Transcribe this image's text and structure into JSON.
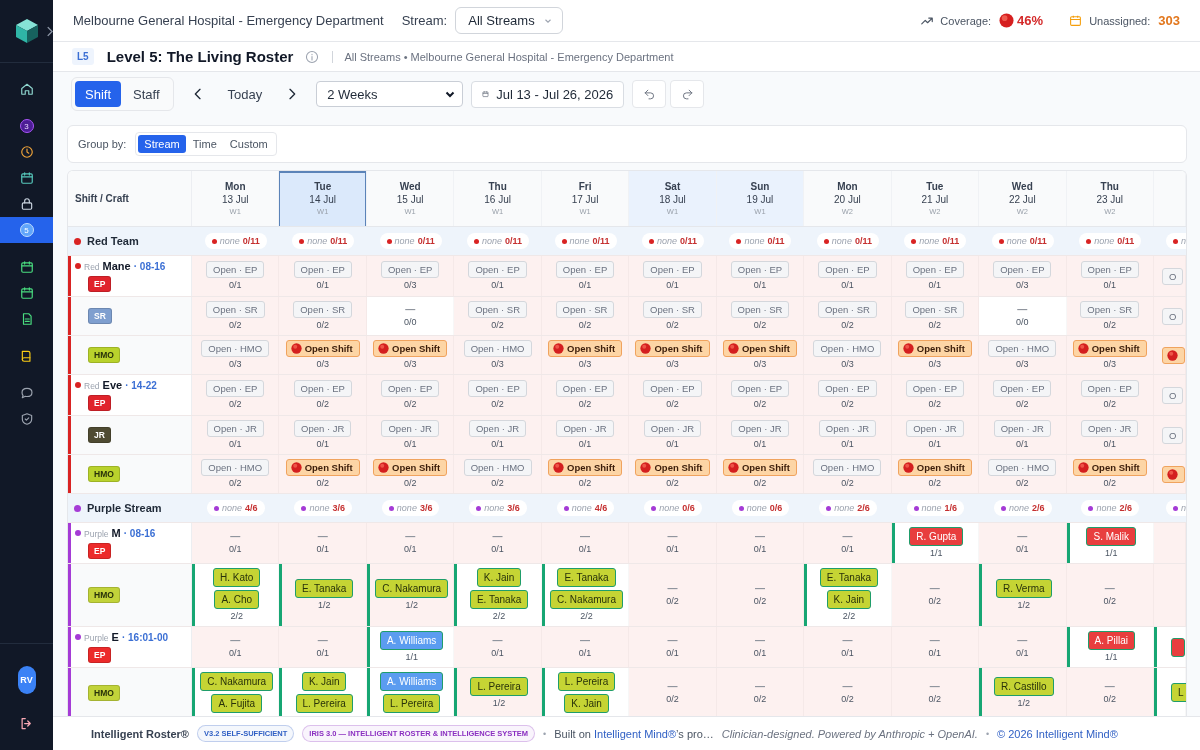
{
  "sidebar": {
    "sections": [
      {
        "items": [
          {
            "selected": false
          }
        ]
      },
      {
        "items": [
          {
            "badge": "3",
            "selected": false
          },
          {
            "selected": false
          },
          {
            "selected": false
          },
          {
            "selected": false
          },
          {
            "badge": "5",
            "selected": true
          }
        ]
      },
      {
        "items": [
          {
            "selected": false
          },
          {
            "selected": false
          },
          {
            "selected": false
          }
        ]
      },
      {
        "items": [
          {
            "selected": false
          }
        ]
      },
      {
        "items": [
          {
            "selected": false
          },
          {
            "selected": false
          }
        ]
      }
    ],
    "user": {
      "initials": "RV"
    }
  },
  "top_bar": {
    "title": "Melbourne General Hospital - Emergency Department",
    "stream_label": "Stream:",
    "stream_select": "All Streams",
    "coverage_label": "Coverage:",
    "coverage_value": "46%",
    "unassigned_label": "Unassigned:",
    "unassigned_value": "303"
  },
  "page_header": {
    "level": "L5",
    "title": "Level 5: The Living Roster",
    "breadcrumb": "All Streams • Melbourne General Hospital - Emergency Department"
  },
  "toolbar": {
    "view_tabs": [
      {
        "label": "Shift",
        "selected": true
      },
      {
        "label": "Staff",
        "selected": false
      }
    ],
    "today": "Today",
    "range_select": "2 Weeks",
    "date_range": "Jul 13 - Jul 26, 2026"
  },
  "group_by": {
    "label": "Group by:",
    "options": [
      {
        "label": "Stream",
        "selected": true
      },
      {
        "label": "Time",
        "selected": false
      },
      {
        "label": "Custom",
        "selected": false
      }
    ]
  },
  "roster": {
    "corner_label": "Shift / Craft",
    "days": [
      {
        "day": "Mon",
        "date": "13 Jul",
        "week": "W1",
        "selected": false,
        "weekend": false
      },
      {
        "day": "Tue",
        "date": "14 Jul",
        "week": "W1",
        "selected": true,
        "weekend": false
      },
      {
        "day": "Wed",
        "date": "15 Jul",
        "week": "W1",
        "selected": false,
        "weekend": false
      },
      {
        "day": "Thu",
        "date": "16 Jul",
        "week": "W1",
        "selected": false,
        "weekend": false
      },
      {
        "day": "Fri",
        "date": "17 Jul",
        "week": "W1",
        "selected": false,
        "weekend": false
      },
      {
        "day": "Sat",
        "date": "18 Jul",
        "week": "W1",
        "selected": false,
        "weekend": true
      },
      {
        "day": "Sun",
        "date": "19 Jul",
        "week": "W1",
        "selected": false,
        "weekend": true
      },
      {
        "day": "Mon",
        "date": "20 Jul",
        "week": "W2",
        "selected": false,
        "weekend": false
      },
      {
        "day": "Tue",
        "date": "21 Jul",
        "week": "W2",
        "selected": false,
        "weekend": false
      },
      {
        "day": "Wed",
        "date": "22 Jul",
        "week": "W2",
        "selected": false,
        "weekend": false
      },
      {
        "day": "Thu",
        "date": "23 Jul",
        "week": "W2",
        "selected": false,
        "weekend": false
      }
    ],
    "groups": [
      {
        "name": "Red Team",
        "color": "#d92323",
        "summary": [
          {
            "label": "none",
            "count": "0/11"
          },
          {
            "label": "none",
            "count": "0/11"
          },
          {
            "label": "none",
            "count": "0/11"
          },
          {
            "label": "none",
            "count": "0/11"
          },
          {
            "label": "none",
            "count": "0/11"
          },
          {
            "label": "none",
            "count": "0/11"
          },
          {
            "label": "none",
            "count": "0/11"
          },
          {
            "label": "none",
            "count": "0/11"
          },
          {
            "label": "none",
            "count": "0/11"
          },
          {
            "label": "none",
            "count": "0/11"
          },
          {
            "label": "none",
            "count": "0/11"
          },
          {
            "label": "n"
          }
        ],
        "shifts": [
          {
            "team": "Red",
            "name": "Mane",
            "time": "· 08-16",
            "crafts": [
              {
                "badge": "EP",
                "color": "#e0242c",
                "cells": [
                  {
                    "kind": "open",
                    "filled": false,
                    "label": "Open · EP",
                    "count": "0/1"
                  },
                  {
                    "kind": "open",
                    "filled": false,
                    "label": "Open · EP",
                    "count": "0/1"
                  },
                  {
                    "kind": "open",
                    "filled": false,
                    "label": "Open · EP",
                    "count": "0/3"
                  },
                  {
                    "kind": "open",
                    "filled": false,
                    "label": "Open · EP",
                    "count": "0/1"
                  },
                  {
                    "kind": "open",
                    "filled": false,
                    "label": "Open · EP",
                    "count": "0/1"
                  },
                  {
                    "kind": "open",
                    "filled": false,
                    "label": "Open · EP",
                    "count": "0/1"
                  },
                  {
                    "kind": "open",
                    "filled": false,
                    "label": "Open · EP",
                    "count": "0/1"
                  },
                  {
                    "kind": "open",
                    "filled": false,
                    "label": "Open · EP",
                    "count": "0/1"
                  },
                  {
                    "kind": "open",
                    "filled": false,
                    "label": "Open · EP",
                    "count": "0/1"
                  },
                  {
                    "kind": "open",
                    "filled": false,
                    "label": "Open · EP",
                    "count": "0/3"
                  },
                  {
                    "kind": "open",
                    "filled": false,
                    "label": "Open · EP",
                    "count": "0/1"
                  },
                  {
                    "kind": "open",
                    "filled": false,
                    "label": "O"
                  }
                ]
              },
              {
                "badge": "SR",
                "color": "#7f9fcf",
                "cells": [
                  {
                    "kind": "open",
                    "filled": false,
                    "label": "Open · SR",
                    "count": "0/2"
                  },
                  {
                    "kind": "open",
                    "filled": false,
                    "label": "Open · SR",
                    "count": "0/2"
                  },
                  {
                    "kind": "vacant",
                    "filled": true,
                    "mark": "—",
                    "count": "0/0"
                  },
                  {
                    "kind": "open",
                    "filled": false,
                    "label": "Open · SR",
                    "count": "0/2"
                  },
                  {
                    "kind": "open",
                    "filled": false,
                    "label": "Open · SR",
                    "count": "0/2"
                  },
                  {
                    "kind": "open",
                    "filled": false,
                    "label": "Open · SR",
                    "count": "0/2"
                  },
                  {
                    "kind": "open",
                    "filled": false,
                    "label": "Open · SR",
                    "count": "0/2"
                  },
                  {
                    "kind": "open",
                    "filled": false,
                    "label": "Open · SR",
                    "count": "0/2"
                  },
                  {
                    "kind": "open",
                    "filled": false,
                    "label": "Open · SR",
                    "count": "0/2"
                  },
                  {
                    "kind": "vacant",
                    "filled": true,
                    "mark": "—",
                    "count": "0/0"
                  },
                  {
                    "kind": "open",
                    "filled": false,
                    "label": "Open · SR",
                    "count": "0/2"
                  },
                  {
                    "kind": "open",
                    "filled": false,
                    "label": "O"
                  }
                ]
              },
              {
                "badge": "HMO",
                "color": "#b9d22c",
                "cells": [
                  {
                    "kind": "open",
                    "filled": false,
                    "label": "Open · HMO",
                    "count": "0/3"
                  },
                  {
                    "kind": "open_shift",
                    "filled": false,
                    "label": "Open Shift",
                    "count": "0/3"
                  },
                  {
                    "kind": "open_shift",
                    "filled": false,
                    "label": "Open Shift",
                    "count": "0/3"
                  },
                  {
                    "kind": "open",
                    "filled": false,
                    "label": "Open · HMO",
                    "count": "0/3"
                  },
                  {
                    "kind": "open_shift",
                    "filled": false,
                    "label": "Open Shift",
                    "count": "0/3"
                  },
                  {
                    "kind": "open_shift",
                    "filled": false,
                    "label": "Open Shift",
                    "count": "0/3"
                  },
                  {
                    "kind": "open_shift",
                    "filled": false,
                    "label": "Open Shift",
                    "count": "0/3"
                  },
                  {
                    "kind": "open",
                    "filled": false,
                    "label": "Open · HMO",
                    "count": "0/3"
                  },
                  {
                    "kind": "open_shift",
                    "filled": false,
                    "label": "Open Shift",
                    "count": "0/3"
                  },
                  {
                    "kind": "open",
                    "filled": false,
                    "label": "Open · HMO",
                    "count": "0/3"
                  },
                  {
                    "kind": "open_shift",
                    "filled": false,
                    "label": "Open Shift",
                    "count": "0/3"
                  },
                  {
                    "kind": "open_shift",
                    "filled": false
                  }
                ]
              }
            ]
          },
          {
            "team": "Red",
            "name": "Eve",
            "time": "· 14-22",
            "crafts": [
              {
                "badge": "EP",
                "color": "#e0242c",
                "cells": [
                  {
                    "kind": "open",
                    "filled": false,
                    "label": "Open · EP",
                    "count": "0/2"
                  },
                  {
                    "kind": "open",
                    "filled": false,
                    "label": "Open · EP",
                    "count": "0/2"
                  },
                  {
                    "kind": "open",
                    "filled": false,
                    "label": "Open · EP",
                    "count": "0/2"
                  },
                  {
                    "kind": "open",
                    "filled": false,
                    "label": "Open · EP",
                    "count": "0/2"
                  },
                  {
                    "kind": "open",
                    "filled": false,
                    "label": "Open · EP",
                    "count": "0/2"
                  },
                  {
                    "kind": "open",
                    "filled": false,
                    "label": "Open · EP",
                    "count": "0/2"
                  },
                  {
                    "kind": "open",
                    "filled": false,
                    "label": "Open · EP",
                    "count": "0/2"
                  },
                  {
                    "kind": "open",
                    "filled": false,
                    "label": "Open · EP",
                    "count": "0/2"
                  },
                  {
                    "kind": "open",
                    "filled": false,
                    "label": "Open · EP",
                    "count": "0/2"
                  },
                  {
                    "kind": "open",
                    "filled": false,
                    "label": "Open · EP",
                    "count": "0/2"
                  },
                  {
                    "kind": "open",
                    "filled": false,
                    "label": "Open · EP",
                    "count": "0/2"
                  },
                  {
                    "kind": "open",
                    "filled": false,
                    "label": "O"
                  }
                ]
              },
              {
                "badge": "JR",
                "color": "#4f4b32",
                "cells": [
                  {
                    "kind": "open",
                    "filled": false,
                    "label": "Open · JR",
                    "count": "0/1"
                  },
                  {
                    "kind": "open",
                    "filled": false,
                    "label": "Open · JR",
                    "count": "0/1"
                  },
                  {
                    "kind": "open",
                    "filled": false,
                    "label": "Open · JR",
                    "count": "0/1"
                  },
                  {
                    "kind": "open",
                    "filled": false,
                    "label": "Open · JR",
                    "count": "0/1"
                  },
                  {
                    "kind": "open",
                    "filled": false,
                    "label": "Open · JR",
                    "count": "0/1"
                  },
                  {
                    "kind": "open",
                    "filled": false,
                    "label": "Open · JR",
                    "count": "0/1"
                  },
                  {
                    "kind": "open",
                    "filled": false,
                    "label": "Open · JR",
                    "count": "0/1"
                  },
                  {
                    "kind": "open",
                    "filled": false,
                    "label": "Open · JR",
                    "count": "0/1"
                  },
                  {
                    "kind": "open",
                    "filled": false,
                    "label": "Open · JR",
                    "count": "0/1"
                  },
                  {
                    "kind": "open",
                    "filled": false,
                    "label": "Open · JR",
                    "count": "0/1"
                  },
                  {
                    "kind": "open",
                    "filled": false,
                    "label": "Open · JR",
                    "count": "0/1"
                  },
                  {
                    "kind": "open",
                    "filled": false,
                    "label": "O"
                  }
                ]
              },
              {
                "badge": "HMO",
                "color": "#b9d22c",
                "cells": [
                  {
                    "kind": "open",
                    "filled": false,
                    "label": "Open · HMO",
                    "count": "0/2"
                  },
                  {
                    "kind": "open_shift",
                    "filled": false,
                    "label": "Open Shift",
                    "count": "0/2"
                  },
                  {
                    "kind": "open_shift",
                    "filled": false,
                    "label": "Open Shift",
                    "count": "0/2"
                  },
                  {
                    "kind": "open",
                    "filled": false,
                    "label": "Open · HMO",
                    "count": "0/2"
                  },
                  {
                    "kind": "open_shift",
                    "filled": false,
                    "label": "Open Shift",
                    "count": "0/2"
                  },
                  {
                    "kind": "open_shift",
                    "filled": false,
                    "label": "Open Shift",
                    "count": "0/2"
                  },
                  {
                    "kind": "open_shift",
                    "filled": false,
                    "label": "Open Shift",
                    "count": "0/2"
                  },
                  {
                    "kind": "open",
                    "filled": false,
                    "label": "Open · HMO",
                    "count": "0/2"
                  },
                  {
                    "kind": "open_shift",
                    "filled": false,
                    "label": "Open Shift",
                    "count": "0/2"
                  },
                  {
                    "kind": "open",
                    "filled": false,
                    "label": "Open · HMO",
                    "count": "0/2"
                  },
                  {
                    "kind": "open_shift",
                    "filled": false,
                    "label": "Open Shift",
                    "count": "0/2"
                  },
                  {
                    "kind": "open_shift",
                    "filled": false
                  }
                ]
              }
            ]
          }
        ]
      },
      {
        "name": "Purple Stream",
        "color": "#a53bd6",
        "summary": [
          {
            "label": "none",
            "count": "4/6"
          },
          {
            "label": "none",
            "count": "3/6"
          },
          {
            "label": "none",
            "count": "3/6"
          },
          {
            "label": "none",
            "count": "3/6"
          },
          {
            "label": "none",
            "count": "4/6"
          },
          {
            "label": "none",
            "count": "0/6"
          },
          {
            "label": "none",
            "count": "0/6"
          },
          {
            "label": "none",
            "count": "2/6"
          },
          {
            "label": "none",
            "count": "1/6"
          },
          {
            "label": "none",
            "count": "2/6"
          },
          {
            "label": "none",
            "count": "2/6"
          },
          {
            "label": "n"
          }
        ],
        "shifts": [
          {
            "team": "Purple",
            "name": "M",
            "time": "· 08-16",
            "crafts": [
              {
                "badge": "EP",
                "color": "#ec2a2a",
                "cells": [
                  {
                    "kind": "vacant",
                    "filled": false,
                    "mark": "—",
                    "count": "0/1"
                  },
                  {
                    "kind": "vacant",
                    "filled": false,
                    "mark": "—",
                    "count": "0/1"
                  },
                  {
                    "kind": "vacant",
                    "filled": false,
                    "mark": "—",
                    "count": "0/1"
                  },
                  {
                    "kind": "vacant",
                    "filled": false,
                    "mark": "—",
                    "count": "0/1"
                  },
                  {
                    "kind": "vacant",
                    "filled": false,
                    "mark": "—",
                    "count": "0/1"
                  },
                  {
                    "kind": "vacant",
                    "filled": false,
                    "mark": "—",
                    "count": "0/1"
                  },
                  {
                    "kind": "vacant",
                    "filled": false,
                    "mark": "—",
                    "count": "0/1"
                  },
                  {
                    "kind": "vacant",
                    "filled": false,
                    "mark": "—",
                    "count": "0/1"
                  },
                  {
                    "kind": "staffed",
                    "filled": true,
                    "people": [
                      {
                        "name": "R. Gupta",
                        "color": "#e83e3e"
                      }
                    ],
                    "count": "1/1"
                  },
                  {
                    "kind": "vacant",
                    "filled": false,
                    "mark": "—",
                    "count": "0/1"
                  },
                  {
                    "kind": "staffed",
                    "filled": true,
                    "people": [
                      {
                        "name": "S. Malik",
                        "color": "#e83e3e"
                      }
                    ],
                    "count": "1/1"
                  },
                  {
                    "kind": "vacant",
                    "filled": false
                  }
                ]
              },
              {
                "badge": "HMO",
                "color": "#c2d33a",
                "cells": [
                  {
                    "kind": "staffed",
                    "filled": true,
                    "people": [
                      {
                        "name": "H. Kato",
                        "color": "#c5d434"
                      },
                      {
                        "name": "A. Cho",
                        "color": "#c5d434"
                      }
                    ],
                    "count": "2/2"
                  },
                  {
                    "kind": "staffed",
                    "filled": false,
                    "people": [
                      {
                        "name": "E. Tanaka",
                        "color": "#c5d434"
                      }
                    ],
                    "count": "1/2"
                  },
                  {
                    "kind": "staffed",
                    "filled": false,
                    "people": [
                      {
                        "name": "C. Nakamura",
                        "color": "#c5d434"
                      }
                    ],
                    "count": "1/2"
                  },
                  {
                    "kind": "staffed",
                    "filled": true,
                    "people": [
                      {
                        "name": "K. Jain",
                        "color": "#c5d434"
                      },
                      {
                        "name": "E. Tanaka",
                        "color": "#c5d434"
                      }
                    ],
                    "count": "2/2"
                  },
                  {
                    "kind": "staffed",
                    "filled": true,
                    "people": [
                      {
                        "name": "E. Tanaka",
                        "color": "#c5d434"
                      },
                      {
                        "name": "C. Nakamura",
                        "color": "#c5d434"
                      }
                    ],
                    "count": "2/2"
                  },
                  {
                    "kind": "vacant",
                    "filled": false,
                    "mark": "—",
                    "count": "0/2"
                  },
                  {
                    "kind": "vacant",
                    "filled": false,
                    "mark": "—",
                    "count": "0/2"
                  },
                  {
                    "kind": "staffed",
                    "filled": true,
                    "people": [
                      {
                        "name": "E. Tanaka",
                        "color": "#c5d434"
                      },
                      {
                        "name": "K. Jain",
                        "color": "#c5d434"
                      }
                    ],
                    "count": "2/2"
                  },
                  {
                    "kind": "vacant",
                    "filled": false,
                    "mark": "—",
                    "count": "0/2"
                  },
                  {
                    "kind": "staffed",
                    "filled": false,
                    "people": [
                      {
                        "name": "R. Verma",
                        "color": "#c5d434"
                      }
                    ],
                    "count": "1/2"
                  },
                  {
                    "kind": "vacant",
                    "filled": false,
                    "mark": "—",
                    "count": "0/2"
                  },
                  {
                    "kind": "vacant",
                    "filled": false
                  }
                ]
              }
            ]
          },
          {
            "team": "Purple",
            "name": "E",
            "time": "· 16:01-00",
            "crafts": [
              {
                "badge": "EP",
                "color": "#ec2a2a",
                "cells": [
                  {
                    "kind": "vacant",
                    "filled": false,
                    "mark": "—",
                    "count": "0/1"
                  },
                  {
                    "kind": "vacant",
                    "filled": false,
                    "mark": "—",
                    "count": "0/1"
                  },
                  {
                    "kind": "staffed",
                    "filled": true,
                    "people": [
                      {
                        "name": "A. Williams",
                        "color": "#5b9cf0"
                      }
                    ],
                    "count": "1/1"
                  },
                  {
                    "kind": "vacant",
                    "filled": false,
                    "mark": "—",
                    "count": "0/1"
                  },
                  {
                    "kind": "vacant",
                    "filled": false,
                    "mark": "—",
                    "count": "0/1"
                  },
                  {
                    "kind": "vacant",
                    "filled": false,
                    "mark": "—",
                    "count": "0/1"
                  },
                  {
                    "kind": "vacant",
                    "filled": false,
                    "mark": "—",
                    "count": "0/1"
                  },
                  {
                    "kind": "vacant",
                    "filled": false,
                    "mark": "—",
                    "count": "0/1"
                  },
                  {
                    "kind": "vacant",
                    "filled": false,
                    "mark": "—",
                    "count": "0/1"
                  },
                  {
                    "kind": "vacant",
                    "filled": false,
                    "mark": "—",
                    "count": "0/1"
                  },
                  {
                    "kind": "staffed",
                    "filled": true,
                    "people": [
                      {
                        "name": "A. Pillai",
                        "color": "#e83e3e"
                      }
                    ],
                    "count": "1/1"
                  },
                  {
                    "kind": "staffed",
                    "filled": true,
                    "people": [
                      {
                        "color": "#e83e3e"
                      }
                    ]
                  }
                ]
              },
              {
                "badge": "HMO",
                "color": "#c2d33a",
                "cells": [
                  {
                    "kind": "staffed",
                    "filled": true,
                    "people": [
                      {
                        "name": "C. Nakamura",
                        "color": "#c5d434"
                      },
                      {
                        "name": "A. Fujita",
                        "color": "#c5d434"
                      }
                    ]
                  },
                  {
                    "kind": "staffed",
                    "filled": true,
                    "people": [
                      {
                        "name": "K. Jain",
                        "color": "#c5d434"
                      },
                      {
                        "name": "L. Pereira",
                        "color": "#c5d434"
                      }
                    ]
                  },
                  {
                    "kind": "staffed",
                    "filled": true,
                    "people": [
                      {
                        "name": "A. Williams",
                        "color": "#5b9cf0"
                      },
                      {
                        "name": "L. Pereira",
                        "color": "#c5d434"
                      }
                    ]
                  },
                  {
                    "kind": "staffed",
                    "filled": false,
                    "people": [
                      {
                        "name": "L. Pereira",
                        "color": "#c5d434"
                      }
                    ],
                    "count": "1/2"
                  },
                  {
                    "kind": "staffed",
                    "filled": true,
                    "people": [
                      {
                        "name": "L. Pereira",
                        "color": "#c5d434"
                      },
                      {
                        "name": "K. Jain",
                        "color": "#c5d434"
                      }
                    ]
                  },
                  {
                    "kind": "vacant",
                    "filled": false,
                    "mark": "—",
                    "count": "0/2"
                  },
                  {
                    "kind": "vacant",
                    "filled": false,
                    "mark": "—",
                    "count": "0/2"
                  },
                  {
                    "kind": "vacant",
                    "filled": false,
                    "mark": "—",
                    "count": "0/2"
                  },
                  {
                    "kind": "vacant",
                    "filled": false,
                    "mark": "—",
                    "count": "0/2"
                  },
                  {
                    "kind": "staffed",
                    "filled": false,
                    "people": [
                      {
                        "name": "R. Castillo",
                        "color": "#c5d434"
                      }
                    ],
                    "count": "1/2"
                  },
                  {
                    "kind": "vacant",
                    "filled": false,
                    "mark": "—",
                    "count": "0/2"
                  },
                  {
                    "kind": "staffed",
                    "filled": true,
                    "people": [
                      {
                        "name": "L",
                        "color": "#c5d434"
                      }
                    ]
                  }
                ]
              }
            ]
          }
        ]
      }
    ]
  },
  "footer": [
    {
      "kind": "brand",
      "text": "Intelligent Roster®"
    },
    {
      "kind": "pill",
      "text": "V3.2 SELF-SUFFICIENT",
      "color": "#2f5fc4"
    },
    {
      "kind": "pill",
      "text": "IRIS 3.0 — INTELLIGENT ROSTER & INTELLIGENCE SYSTEM",
      "color": "#8a2fc0"
    },
    {
      "kind": "separator",
      "text": "•"
    },
    {
      "kind": "credit",
      "before": "Built on ",
      "link": "Intelligent Mind®",
      "after": "’s pro…"
    },
    {
      "kind": "tagline",
      "text": "Clinician-designed. Powered by Anthropic + OpenAI."
    },
    {
      "kind": "separator",
      "text": "•"
    },
    {
      "kind": "link",
      "text": "© 2026 Intelligent Mind®"
    }
  ]
}
